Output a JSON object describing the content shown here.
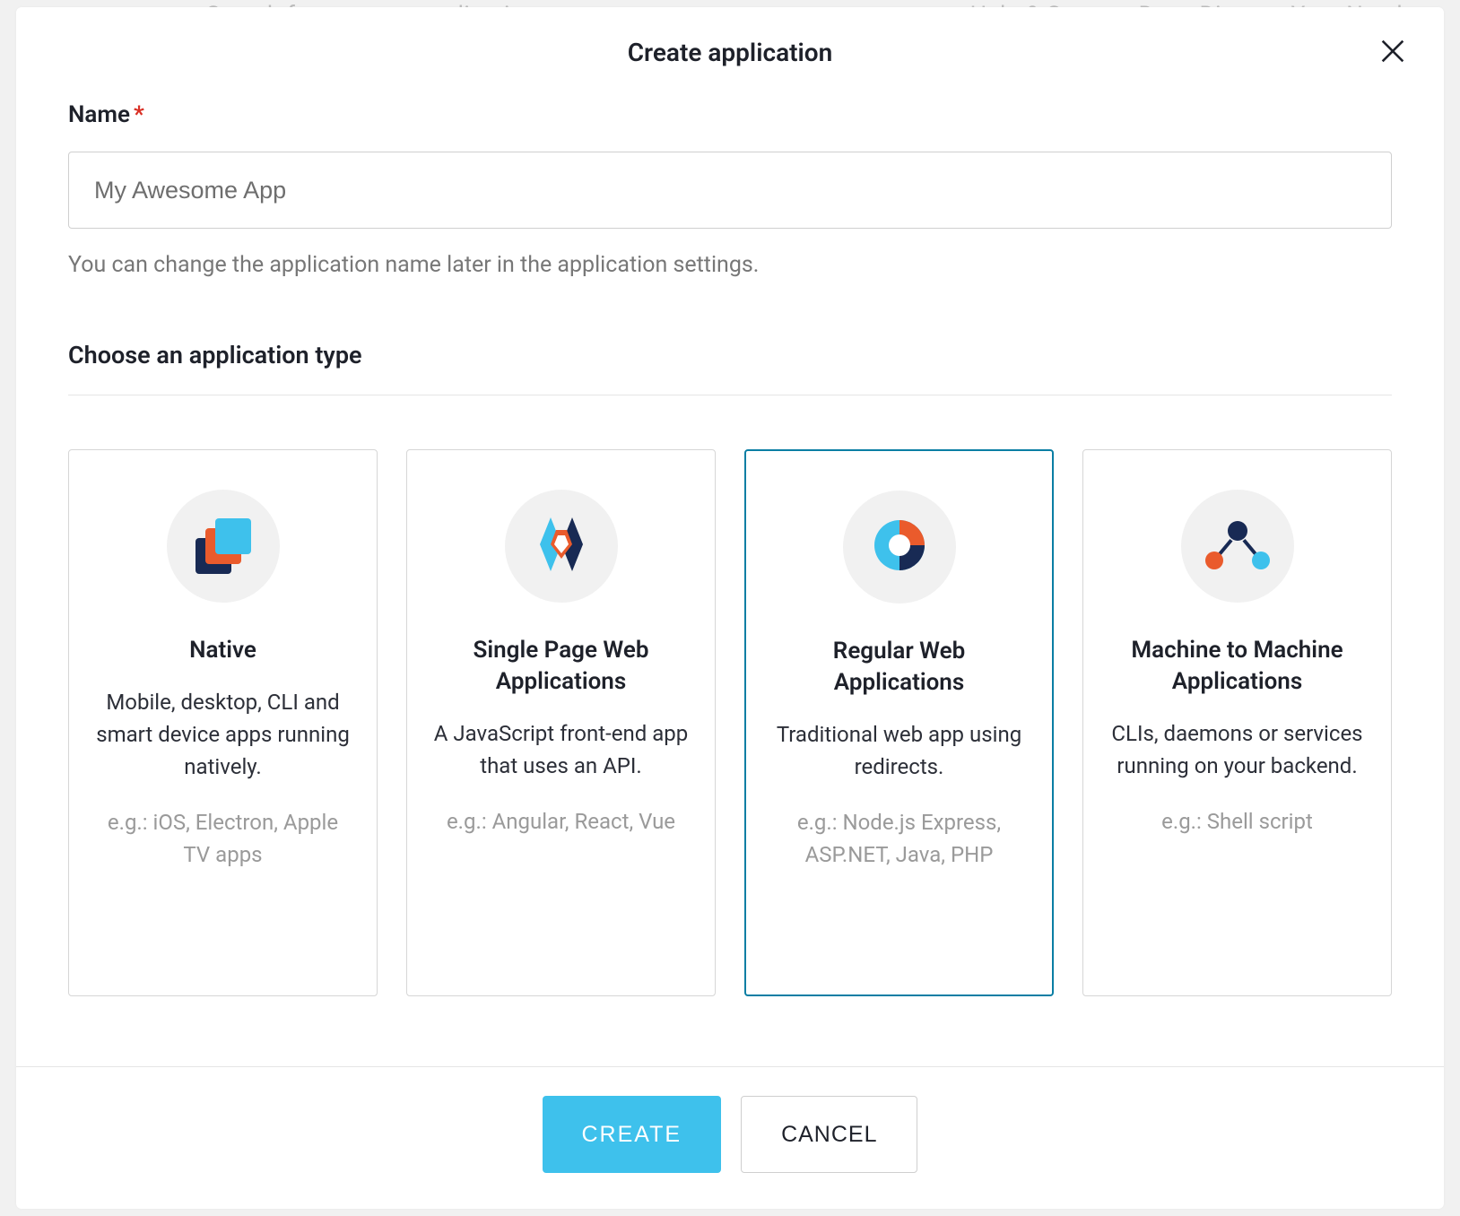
{
  "backdrop": {
    "left": "Search for users or applications",
    "right": "Help & Support    Docs    Discuss Your Needs"
  },
  "modal": {
    "title": "Create application",
    "close_icon": "close-icon"
  },
  "form": {
    "name_label": "Name",
    "name_required_mark": "*",
    "name_placeholder": "My Awesome App",
    "name_helper": "You can change the application name later in the application settings.",
    "type_label": "Choose an application type"
  },
  "app_types": [
    {
      "id": "native",
      "title": "Native",
      "description": "Mobile, desktop, CLI and smart device apps running natively.",
      "examples": "e.g.: iOS, Electron, Apple TV apps",
      "selected": false
    },
    {
      "id": "spa",
      "title": "Single Page Web Applications",
      "description": "A JavaScript front-end app that uses an API.",
      "examples": "e.g.: Angular, React, Vue",
      "selected": false
    },
    {
      "id": "regular",
      "title": "Regular Web Applications",
      "description": "Traditional web app using redirects.",
      "examples": "e.g.: Node.js Express, ASP.NET, Java, PHP",
      "selected": true
    },
    {
      "id": "m2m",
      "title": "Machine to Machine Applications",
      "description": "CLIs, daemons or services running on your backend.",
      "examples": "e.g.: Shell script",
      "selected": false
    }
  ],
  "footer": {
    "create_label": "CREATE",
    "cancel_label": "CANCEL"
  }
}
